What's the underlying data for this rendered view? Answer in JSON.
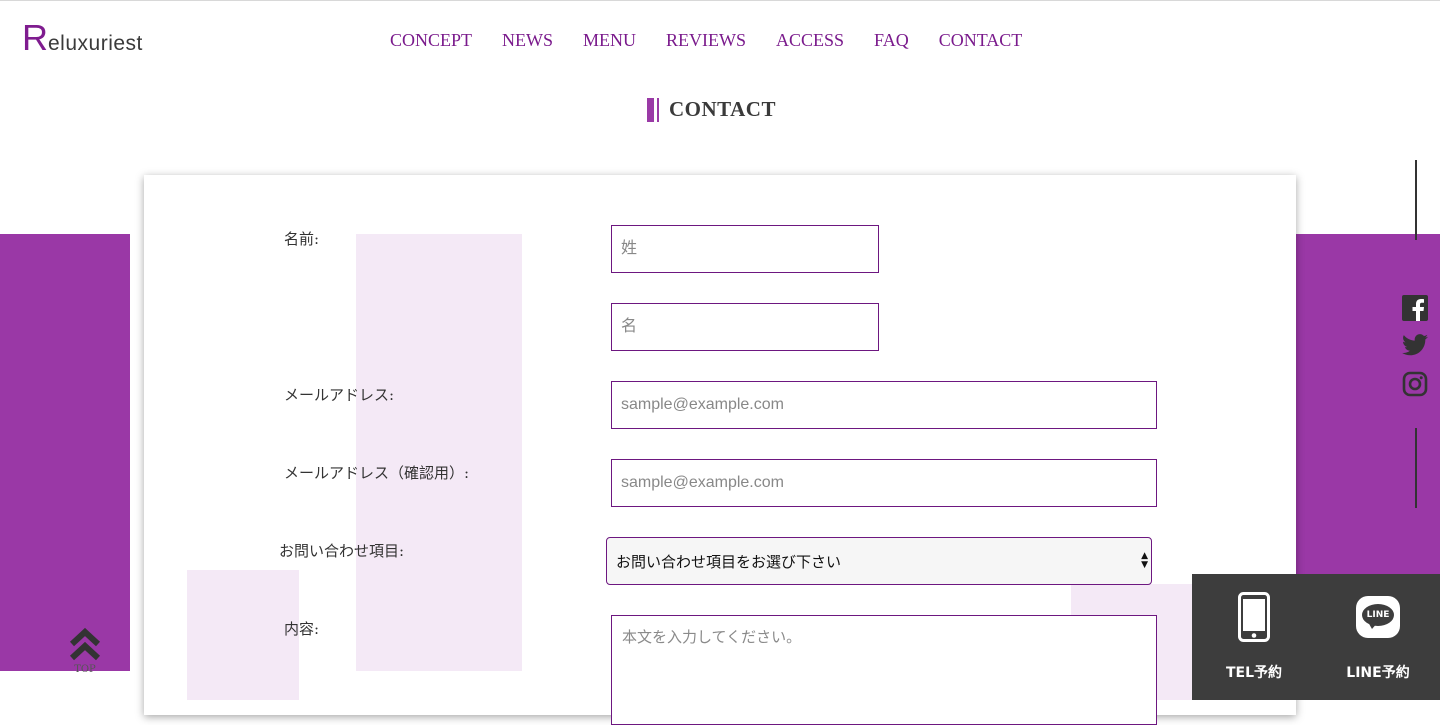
{
  "brand": {
    "initial": "R",
    "rest": "eluxuriest"
  },
  "nav": [
    "CONCEPT",
    "NEWS",
    "MENU",
    "REVIEWS",
    "ACCESS",
    "FAQ",
    "CONTACT"
  ],
  "page": {
    "title": "CONTACT"
  },
  "form": {
    "name_label": "名前:",
    "last_name_placeholder": "姓",
    "first_name_placeholder": "名",
    "email_label": "メールアドレス:",
    "email_placeholder": "sample@example.com",
    "email_confirm_label": "メールアドレス（確認用）:",
    "email_confirm_placeholder": "sample@example.com",
    "inquiry_label": "お問い合わせ項目:",
    "inquiry_selected": "お問い合わせ項目をお選び下さい",
    "content_label": "内容:",
    "content_placeholder": "本文を入力してください。"
  },
  "social": [
    "facebook-icon",
    "twitter-icon",
    "instagram-icon"
  ],
  "top_button": {
    "label": "TOP",
    "icon": "double-chevron-up-icon"
  },
  "reserve": {
    "tel_label": "TEL予約",
    "tel_icon": "smartphone-icon",
    "line_label": "LINE予約",
    "line_icon": "line-icon",
    "line_badge": "LINE"
  },
  "colors": {
    "accent": "#9a38a6",
    "nav": "#7a1a8c",
    "field_border": "#6d1780",
    "deco": "#f4e9f6",
    "reserve_bg": "#3d3d3d"
  }
}
